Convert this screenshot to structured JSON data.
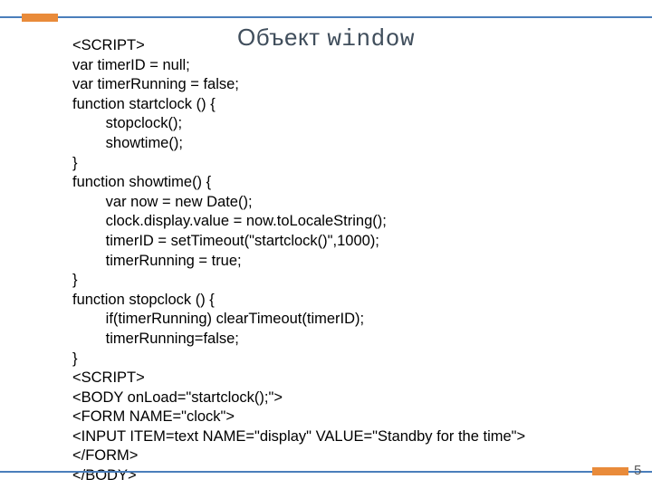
{
  "title": {
    "word1": "Объект",
    "word2": "window"
  },
  "code": "<SCRIPT>\nvar timerID = null;\nvar timerRunning = false;\nfunction startclock () {\n        stopclock();\n        showtime();\n}\nfunction showtime() {\n        var now = new Date();\n        clock.display.value = now.toLocaleString();\n        timerID = setTimeout(\"startclock()\",1000);\n        timerRunning = true;\n}\nfunction stopclock () {\n        if(timerRunning) clearTimeout(timerID);\n        timerRunning=false;\n}\n<SCRIPT>\n<BODY onLoad=\"startclock();\">\n<FORM NAME=\"clock\">\n<INPUT ITEM=text NAME=\"display\" VALUE=\"Standby for the time\">\n</FORM>\n</BODY>",
  "page_number": "5"
}
